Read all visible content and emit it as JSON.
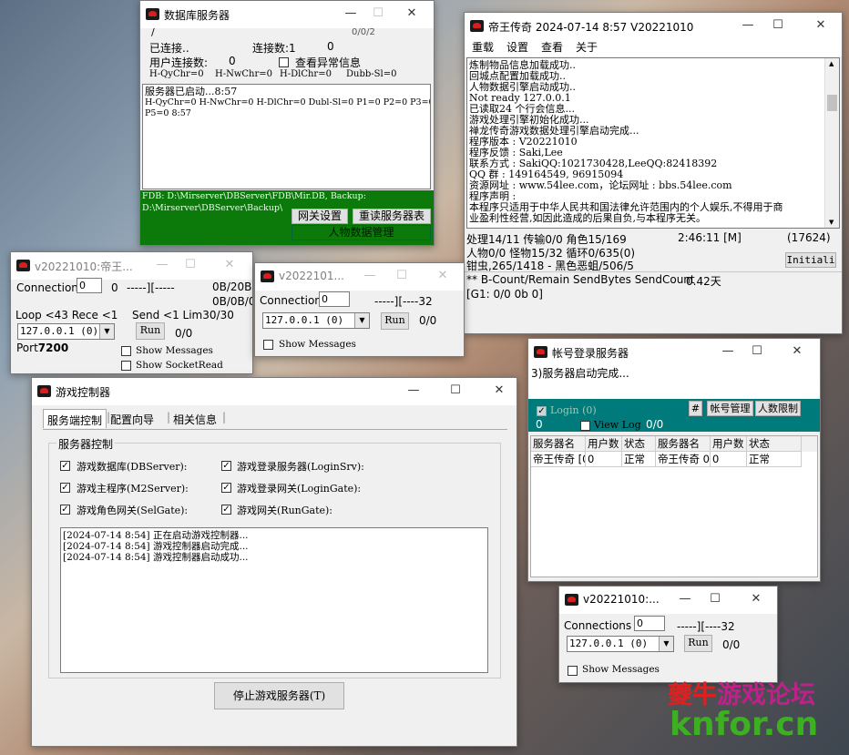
{
  "db_window": {
    "title": "数据库服务器",
    "slash": "/",
    "counter": "0/0/2",
    "connected_label": "已连接..",
    "conn_count_label": "连接数:1",
    "conn_count_value": "0",
    "user_conn_label": "用户连接数:",
    "user_conn_value": "0",
    "check_abnormal_label": "查看异常信息",
    "stats": [
      "H-QyChr=0",
      "H-NwChr=0",
      "H-DlChr=0",
      "Dubb-Sl=0"
    ],
    "log": [
      "服务器已启动...8:57",
      "H-QyChr=0 H-NwChr=0 H-DlChr=0 Dubl-Sl=0 P1=0 P2=0 P3=0 P4=0",
      "P5=0 8:57"
    ],
    "path1": "FDB: D:\\Mirserver\\DBServer\\FDB\\Mir.DB, Backup:",
    "path2": "D:\\Mirserver\\DBServer\\Backup\\",
    "btn_gateway": "网关设置",
    "btn_reload": "重读服务器表",
    "btn_people": "人物数据管理"
  },
  "m2_window": {
    "title": "帝王传奇 2024-07-14 8:57 V20221010",
    "menu": [
      "重载",
      "设置",
      "查看",
      "关于"
    ],
    "log": [
      "炼制物品信息加载成功..",
      "回城点配置加载成功..",
      "人物数据引擎启动成功..",
      "Not ready 127.0.0.1",
      "已读取24 个行会信息...",
      "游戏处理引擎初始化成功...",
      "禅龙传奇游戏数据处理引擎启动完成...",
      "程序版本 : V20221010",
      "程序反馈 : Saki,Lee",
      "联系方式 : SakiQQ:1021730428,LeeQQ:82418392",
      "QQ    群 : 149164549, 96915094",
      "资源网址 : www.54lee.com，论坛网址 : bbs.54lee.com",
      "程序声明 :",
      "本程序只适用于中华人民共和国法律允许范围内的个人娱乐,不得用于商",
      "业盈利性经营,如因此造成的后果自负,与本程序无关。"
    ],
    "status1": "处理14/11 传输0/0 角色15/169",
    "status_time": "2:46:11 [M]",
    "status_num": "(17624)",
    "status2": "人物0/0 怪物15/32 循环0/635(0)",
    "status3": "钳虫,265/1418 - 黑色恶蛆/506/5",
    "init_button": "Initiali",
    "count_line": "** B-Count/Remain SendBytes SendCount",
    "count_days": "0.42天",
    "g1": "[G1: 0/0 0b 0]"
  },
  "gate1": {
    "title": "v20221010:帝王...",
    "connection_label": "Connection",
    "connection_value": "0",
    "conn_num": "0",
    "dash": "-----][-----",
    "size1": "0B/20B",
    "size2": "0B/0B/0",
    "loop": "Loop <43  Rece <1",
    "send": "Send <1 Lim30/30",
    "ip": "127.0.0.1 (0)",
    "run": "Run",
    "count": "0/0",
    "port_label": "Port",
    "port_value": "7200",
    "show_messages": "Show Messages",
    "show_socket": "Show SocketRead"
  },
  "gate2": {
    "title": "v2022101...",
    "connection_label": "Connection",
    "connection_value": "0",
    "dash": "-----][----32",
    "ip": "127.0.0.1 (0)",
    "run": "Run",
    "count": "0/0",
    "show_messages": "Show Messages"
  },
  "gate3": {
    "title": "v20221010:...",
    "connection_label": "Connections",
    "connection_value": "0",
    "dash": "-----][----32",
    "ip": "127.0.0.1 (0)",
    "run": "Run",
    "count": "0/0",
    "show_messages": "Show Messages"
  },
  "login_window": {
    "title": "帐号登录服务器",
    "status": "3)服务器启动完成...",
    "login_check": "Login (0)",
    "hash_btn": "#",
    "btn_account": "帐号管理",
    "btn_limit": "人数限制",
    "field_value": "0",
    "view_log": "View Log",
    "count": "0/0",
    "columns": [
      "服务器名",
      "用户数",
      "状态",
      "服务器名",
      "用户数",
      "状态"
    ],
    "row": [
      "帝王传奇 [0",
      "0",
      "正常",
      "帝王传奇 0",
      "0",
      "正常"
    ]
  },
  "control_window": {
    "title": "游戏控制器",
    "tabs": [
      "服务端控制",
      "配置向导",
      "相关信息"
    ],
    "group_title": "服务器控制",
    "checks": [
      "游戏数据库(DBServer):",
      "游戏登录服务器(LoginSrv):",
      "游戏主程序(M2Server):",
      "游戏登录网关(LoginGate):",
      "游戏角色网关(SelGate):",
      "游戏网关(RunGate):"
    ],
    "log": [
      "[2024-07-14 8:54] 正在启动游戏控制器...",
      "[2024-07-14 8:54] 游戏控制器启动完成...",
      "[2024-07-14 8:54] 游戏控制器启动成功..."
    ],
    "stop_button": "停止游戏服务器(T)"
  },
  "watermark": {
    "line1_a": "夔",
    "line1_b": "牛",
    "line1_c": "游戏论坛",
    "line2": "knfor.cn"
  },
  "colors": {
    "green_panel": "#0b7a0b",
    "teal_panel": "#007a7a",
    "title_red": "#d81e1e"
  }
}
